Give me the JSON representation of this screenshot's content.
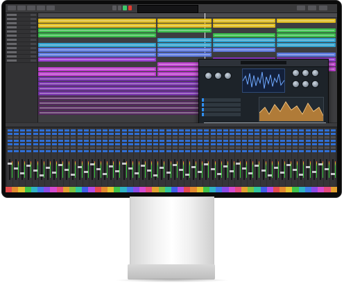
{
  "app": {
    "name": ""
  },
  "transport": {
    "lcd_text": ""
  },
  "colors": {
    "accent": "#2f8ef0",
    "record": "#e23b2f",
    "play": "#3ec96b",
    "bezel": "#0b0b0b"
  },
  "regions": [
    {
      "lane": 0,
      "color": "#e9c21a"
    },
    {
      "lane": 1,
      "color": "#e9c21a"
    },
    {
      "lane": 2,
      "color": "#37c24a"
    },
    {
      "lane": 3,
      "color": "#37c24a"
    },
    {
      "lane": 4,
      "color": "#2fa7d6"
    },
    {
      "lane": 5,
      "color": "#2fa7d6"
    },
    {
      "lane": 6,
      "color": "#5b7ae6"
    },
    {
      "lane": 7,
      "color": "#5b7ae6"
    },
    {
      "lane": 8,
      "color": "#9a3ad8"
    },
    {
      "lane": 9,
      "color": "#c23dd4"
    },
    {
      "lane": 10,
      "color": "#c23dd4"
    },
    {
      "lane": 11,
      "color": "#c23dd4"
    }
  ],
  "mixer": {
    "channel_count": 52
  },
  "colorstrip": [
    "#e34b4b",
    "#e38a2f",
    "#e3c42f",
    "#3fc24a",
    "#2fb3c4",
    "#3f7ae6",
    "#8a4ae6",
    "#d44ad0",
    "#e34b7a",
    "#e3a02f",
    "#7ac23f",
    "#2fc4a0",
    "#3f5ee6",
    "#b44ae6"
  ],
  "icons": [
    "play-icon",
    "record-icon",
    "rewind-icon",
    "stop-icon"
  ]
}
